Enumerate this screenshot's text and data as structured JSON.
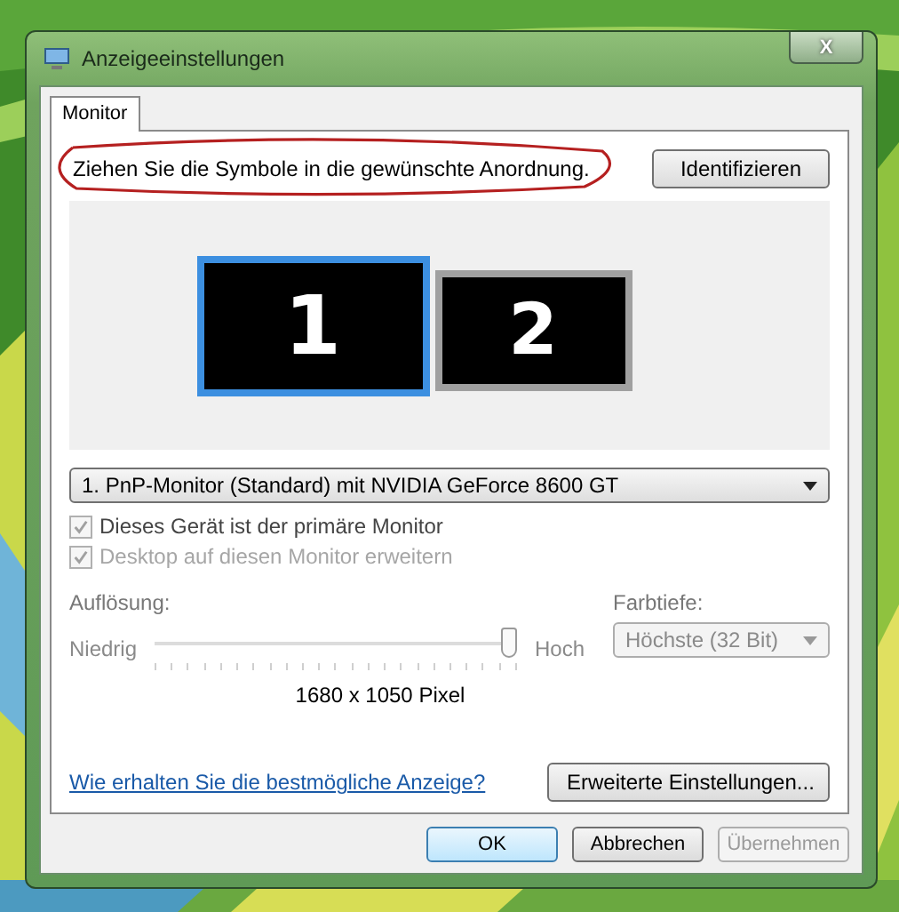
{
  "window": {
    "title": "Anzeigeeinstellungen",
    "close_label": "X"
  },
  "tabs": [
    {
      "label": "Monitor",
      "selected": true
    }
  ],
  "instruction": "Ziehen Sie die Symbole in die gewünschte Anordnung.",
  "identify_button": "Identifizieren",
  "monitors": [
    {
      "label": "1",
      "selected": true
    },
    {
      "label": "2",
      "selected": false
    }
  ],
  "display_select": {
    "value": "1. PnP-Monitor (Standard) mit NVIDIA GeForce 8600 GT"
  },
  "checkboxes": [
    {
      "label": "Dieses Gerät ist der primäre Monitor",
      "checked": true,
      "disabled": false
    },
    {
      "label": "Desktop auf diesen Monitor erweitern",
      "checked": true,
      "disabled": true
    }
  ],
  "resolution": {
    "label": "Auflösung:",
    "low": "Niedrig",
    "high": "Hoch",
    "level": 1,
    "value": "1680 x 1050 Pixel",
    "disabled": true
  },
  "color_depth": {
    "label": "Farbtiefe:",
    "value": "Höchste (32 Bit)",
    "disabled": true
  },
  "help_link": "Wie erhalten Sie die bestmögliche Anzeige?",
  "advanced_button": "Erweiterte Einstellungen...",
  "buttons": [
    {
      "label": "OK",
      "default": true,
      "disabled": false
    },
    {
      "label": "Abbrechen",
      "default": false,
      "disabled": false
    },
    {
      "label": "Übernehmen",
      "default": false,
      "disabled": true
    }
  ]
}
